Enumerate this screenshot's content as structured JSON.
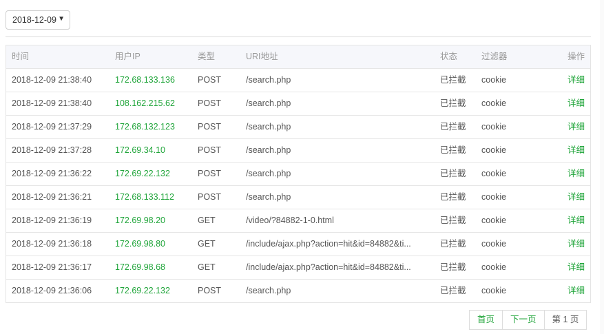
{
  "date_select": {
    "value": "2018-12-09",
    "caret": "▼"
  },
  "table": {
    "headers": {
      "time": "时间",
      "ip": "用户IP",
      "type": "类型",
      "uri": "URI地址",
      "status": "状态",
      "filter": "过滤器",
      "op": "操作"
    },
    "rows": [
      {
        "time": "2018-12-09 21:38:40",
        "ip": "172.68.133.136",
        "type": "POST",
        "uri": "/search.php",
        "status": "已拦截",
        "filter": "cookie",
        "op": "详细"
      },
      {
        "time": "2018-12-09 21:38:40",
        "ip": "108.162.215.62",
        "type": "POST",
        "uri": "/search.php",
        "status": "已拦截",
        "filter": "cookie",
        "op": "详细"
      },
      {
        "time": "2018-12-09 21:37:29",
        "ip": "172.68.132.123",
        "type": "POST",
        "uri": "/search.php",
        "status": "已拦截",
        "filter": "cookie",
        "op": "详细"
      },
      {
        "time": "2018-12-09 21:37:28",
        "ip": "172.69.34.10",
        "type": "POST",
        "uri": "/search.php",
        "status": "已拦截",
        "filter": "cookie",
        "op": "详细"
      },
      {
        "time": "2018-12-09 21:36:22",
        "ip": "172.69.22.132",
        "type": "POST",
        "uri": "/search.php",
        "status": "已拦截",
        "filter": "cookie",
        "op": "详细"
      },
      {
        "time": "2018-12-09 21:36:21",
        "ip": "172.68.133.112",
        "type": "POST",
        "uri": "/search.php",
        "status": "已拦截",
        "filter": "cookie",
        "op": "详细"
      },
      {
        "time": "2018-12-09 21:36:19",
        "ip": "172.69.98.20",
        "type": "GET",
        "uri": "/video/?84882-1-0.html",
        "status": "已拦截",
        "filter": "cookie",
        "op": "详细"
      },
      {
        "time": "2018-12-09 21:36:18",
        "ip": "172.69.98.80",
        "type": "GET",
        "uri": "/include/ajax.php?action=hit&id=84882&ti...",
        "status": "已拦截",
        "filter": "cookie",
        "op": "详细"
      },
      {
        "time": "2018-12-09 21:36:17",
        "ip": "172.69.98.68",
        "type": "GET",
        "uri": "/include/ajax.php?action=hit&id=84882&ti...",
        "status": "已拦截",
        "filter": "cookie",
        "op": "详细"
      },
      {
        "time": "2018-12-09 21:36:06",
        "ip": "172.69.22.132",
        "type": "POST",
        "uri": "/search.php",
        "status": "已拦截",
        "filter": "cookie",
        "op": "详细"
      }
    ]
  },
  "pager": {
    "first": "首页",
    "next": "下一页",
    "current": "第 1 页"
  }
}
